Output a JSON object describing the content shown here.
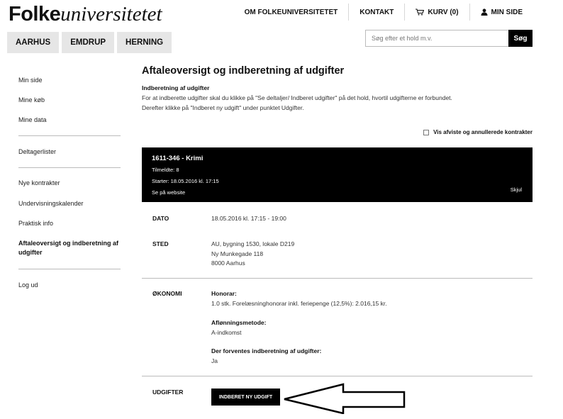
{
  "logo": {
    "bold": "Folke",
    "script": "universitetet"
  },
  "topnav": {
    "about": "OM FOLKEUNIVERSITETET",
    "contact": "KONTAKT",
    "cart": "KURV (0)",
    "mypage": "MIN SIDE"
  },
  "tabs": [
    "AARHUS",
    "EMDRUP",
    "HERNING"
  ],
  "search": {
    "placeholder": "Søg efter et hold m.v.",
    "button": "Søg"
  },
  "sidebar": {
    "min_side": "Min side",
    "mine_koeb": "Mine køb",
    "mine_data": "Mine data",
    "deltagerlister": "Deltagerlister",
    "nye_kontrakter": "Nye kontrakter",
    "undervisningskalender": "Undervisningskalender",
    "praktisk_info": "Praktisk info",
    "aftaleoversigt": "Aftaleoversigt og indberetning af udgifter",
    "log_ud": "Log ud"
  },
  "page": {
    "title": "Aftaleoversigt og indberetning af udgifter",
    "intro_heading": "Indberetning af udgifter",
    "intro_line1": "For at indberette udgifter skal du klikke på \"Se deltaljer/ Indberet udgifter\" på det hold, hvortil udgifterne er forbundet.",
    "intro_line2": "Derefter klikke på \"Indberet ny udgift\" under punktet Udgifter.",
    "show_rejected": "Vis afviste og annullerede kontrakter"
  },
  "course": {
    "title": "1611-346 - Krimi",
    "enrolled": "Tilmeldte: 8",
    "starts": "Starter: 18.05.2016 kl. 17:15",
    "website": "Se på website",
    "hide": "Skjul"
  },
  "details": {
    "dato_label": "DATO",
    "dato_value": "18.05.2016 kl. 17:15 - 19:00",
    "sted_label": "STED",
    "sted_line1": "AU, bygning 1530, lokale D219",
    "sted_line2": "Ny Munkegade 118",
    "sted_line3": "8000 Aarhus",
    "oekonomi_label": "ØKONOMI",
    "honorar_heading": "Honorar:",
    "honorar_value": "1.0 stk. Forelæsninghonorar inkl. feriepenge (12,5%): 2.016,15 kr.",
    "afloenning_heading": "Aflønningsmetode:",
    "afloenning_value": "A-indkomst",
    "forventes_heading": "Der forventes indberetning af udgifter:",
    "forventes_value": "Ja",
    "udgifter_label": "UDGIFTER",
    "indberet_button": "INDBERET NY UDGIFT"
  }
}
